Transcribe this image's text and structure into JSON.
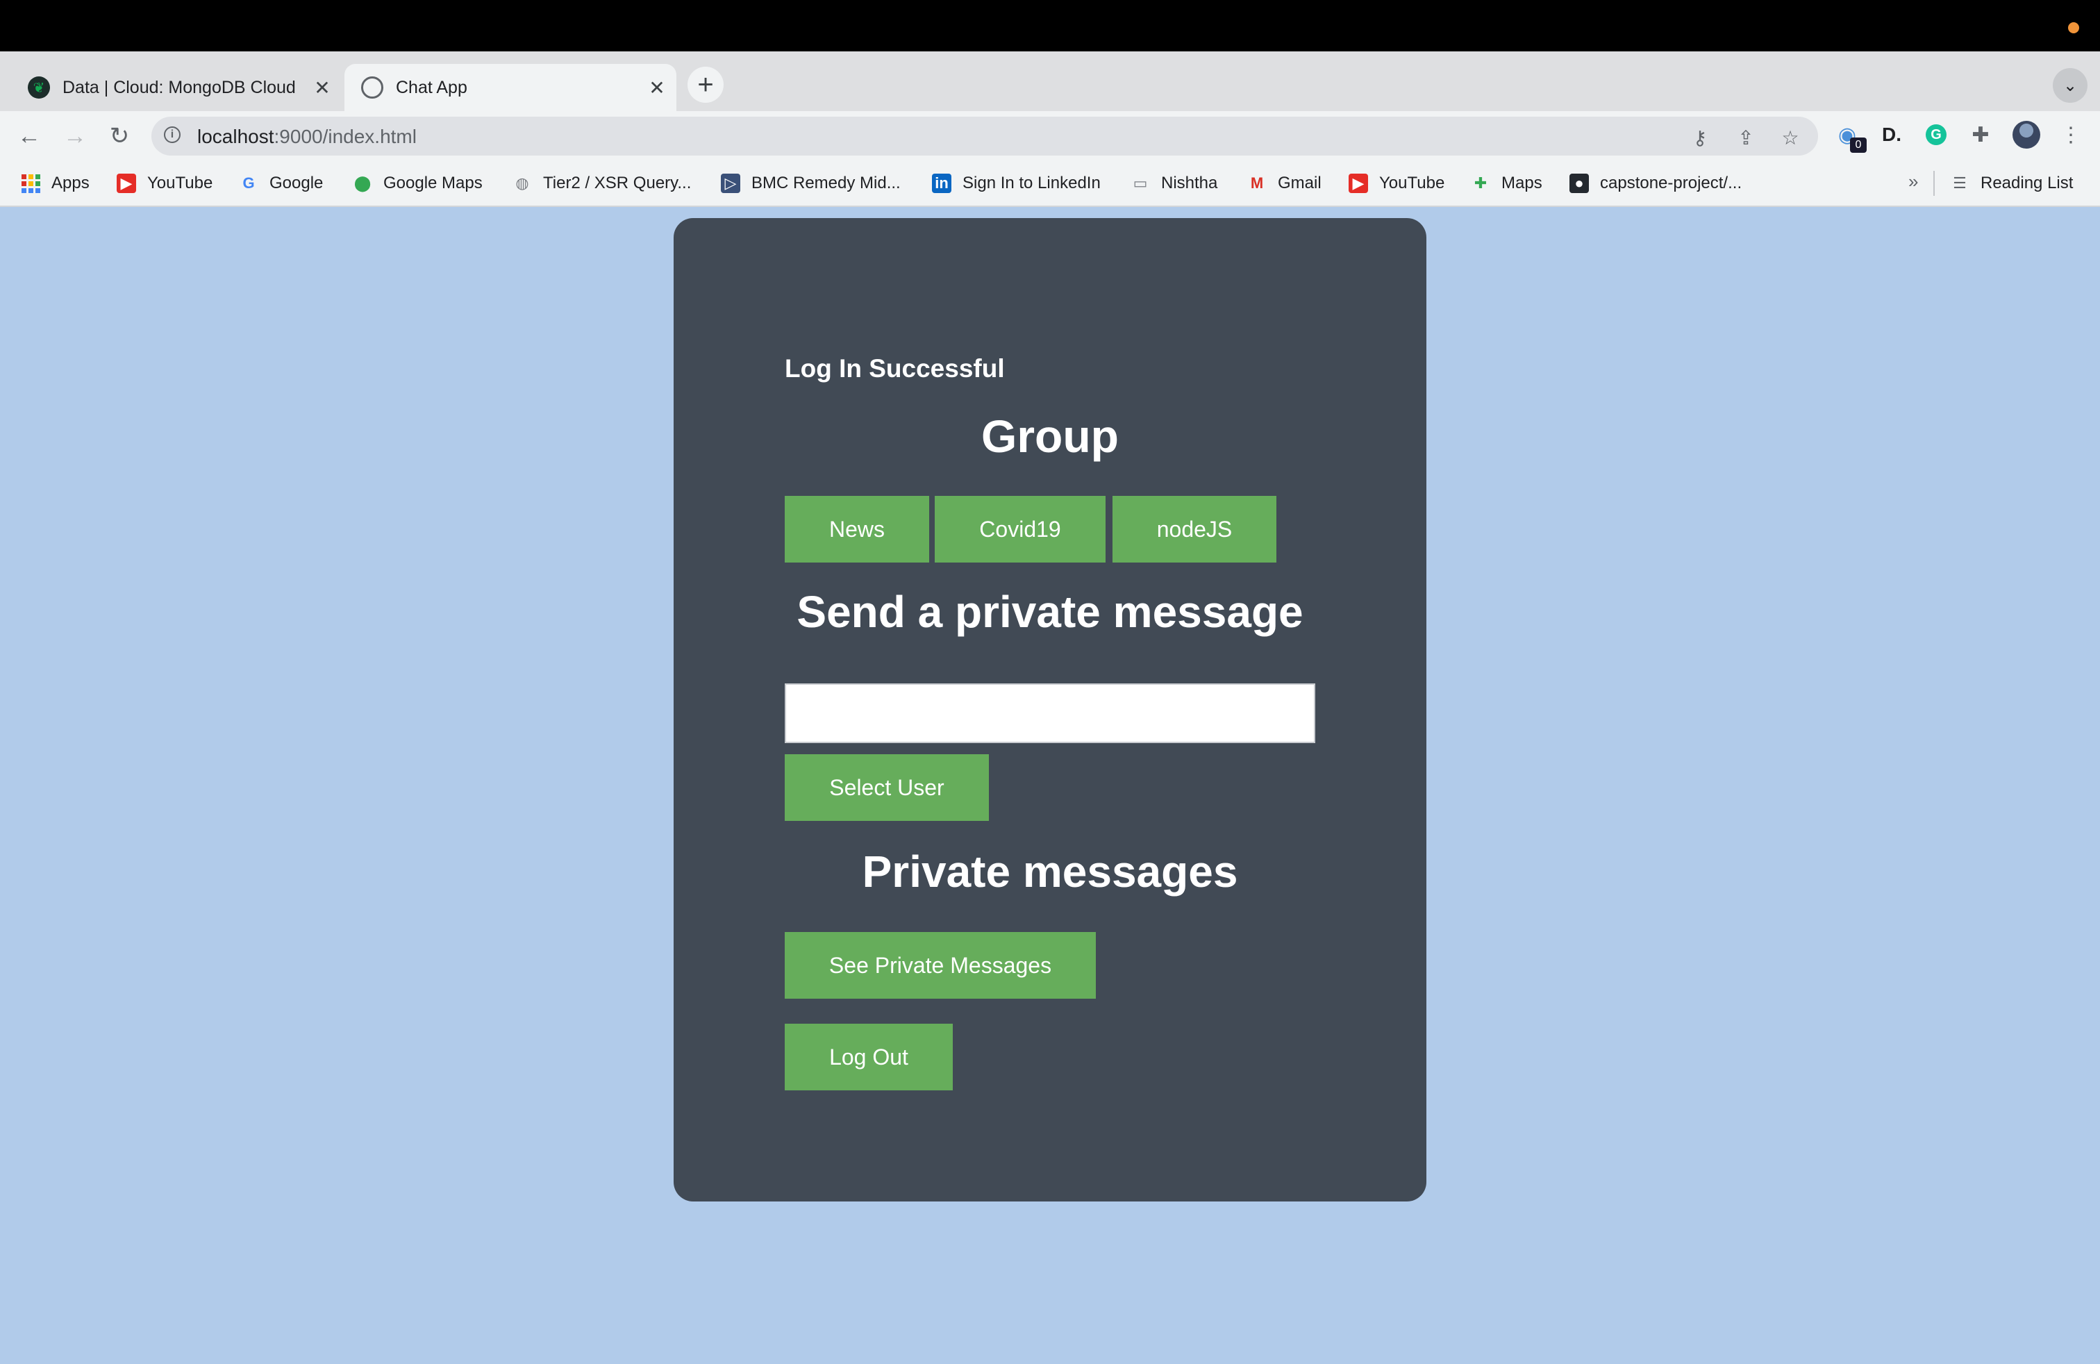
{
  "browser": {
    "tabs": [
      {
        "title": "Data | Cloud: MongoDB Cloud",
        "icon": "mongodb-leaf-icon",
        "active": false
      },
      {
        "title": "Chat App",
        "icon": "globe-icon",
        "active": true
      }
    ],
    "close_glyph": "✕",
    "new_tab_glyph": "+",
    "tab_list_glyph": "⌄",
    "address": {
      "host": "localhost",
      "path": ":9000/index.html",
      "info_glyph": "i"
    },
    "nav": {
      "back": "←",
      "forward": "→",
      "reload": "↻"
    },
    "omni_icons": {
      "key": "⚷",
      "share": "⇪",
      "star": "☆"
    },
    "extensions": {
      "badge": "0",
      "d_ext": "D.",
      "grammarly": "G",
      "puzzle": "✚",
      "menu": "⋮"
    },
    "bookmarks": [
      {
        "label": "Apps",
        "icon": "apps-grid-icon"
      },
      {
        "label": "YouTube",
        "icon": "youtube-icon"
      },
      {
        "label": "Google",
        "icon": "google-icon"
      },
      {
        "label": "Google Maps",
        "icon": "google-maps-icon"
      },
      {
        "label": "Tier2 / XSR Query...",
        "icon": "globe-icon"
      },
      {
        "label": "BMC Remedy Mid...",
        "icon": "bmc-icon"
      },
      {
        "label": "Sign In to LinkedIn",
        "icon": "linkedin-icon"
      },
      {
        "label": "Nishtha",
        "icon": "folder-icon"
      },
      {
        "label": "Gmail",
        "icon": "gmail-icon"
      },
      {
        "label": "YouTube",
        "icon": "youtube-icon"
      },
      {
        "label": "Maps",
        "icon": "maps-icon"
      },
      {
        "label": "capstone-project/...",
        "icon": "github-icon"
      }
    ],
    "bookmarks_more": "»",
    "reading_list": "Reading List"
  },
  "page": {
    "status": "Log In Successful",
    "group_heading": "Group",
    "groups": [
      "News",
      "Covid19",
      "nodeJS"
    ],
    "private_heading": "Send a private message",
    "recipient_input": {
      "value": "",
      "placeholder": ""
    },
    "select_user_label": "Select User",
    "private_messages_heading": "Private messages",
    "see_private_label": "See Private Messages",
    "logout_label": "Log Out"
  },
  "colors": {
    "page_bg": "#b1cbea",
    "card_bg": "#414a55",
    "button_bg": "#66ad5b",
    "text": "#ffffff"
  }
}
